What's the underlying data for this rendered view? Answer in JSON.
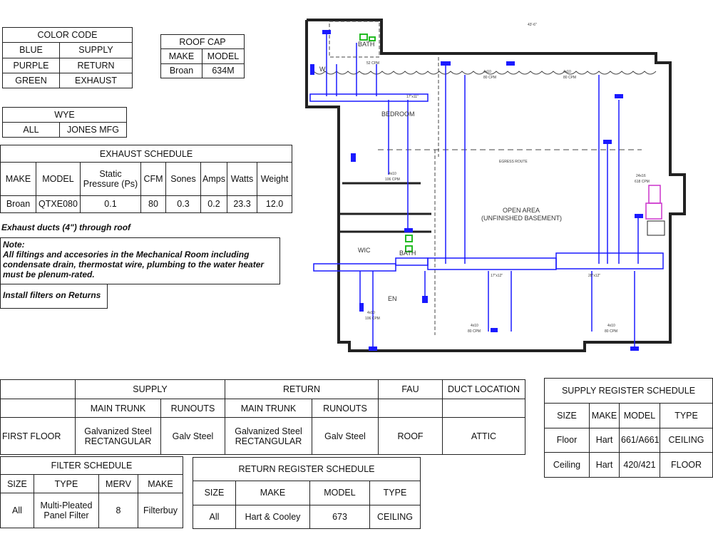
{
  "tables": {
    "color_code": {
      "rows": [
        [
          {
            "t": "COLOR CODE",
            "c": 2
          }
        ],
        [
          {
            "t": "BLUE"
          },
          {
            "t": "SUPPLY"
          }
        ],
        [
          {
            "t": "PURPLE"
          },
          {
            "t": "RETURN"
          }
        ],
        [
          {
            "t": "GREEN"
          },
          {
            "t": "EXHAUST"
          }
        ]
      ]
    },
    "roof_cap": {
      "rows": [
        [
          {
            "t": "ROOF CAP",
            "c": 2
          }
        ],
        [
          {
            "t": "MAKE"
          },
          {
            "t": "MODEL"
          }
        ],
        [
          {
            "t": "Broan"
          },
          {
            "t": "634M"
          }
        ]
      ]
    },
    "wye": {
      "rows": [
        [
          {
            "t": "WYE",
            "c": 2
          }
        ],
        [
          {
            "t": "ALL"
          },
          {
            "t": "JONES MFG"
          }
        ]
      ]
    },
    "exhaust_schedule": {
      "rows": [
        [
          {
            "t": "EXHAUST SCHEDULE",
            "c": 8
          }
        ],
        [
          {
            "t": "MAKE"
          },
          {
            "t": "MODEL"
          },
          {
            "t": "Static Pressure (Ps)"
          },
          {
            "t": "CFM"
          },
          {
            "t": "Sones"
          },
          {
            "t": "Amps"
          },
          {
            "t": "Watts"
          },
          {
            "t": "Weight"
          }
        ],
        [
          {
            "t": "Broan"
          },
          {
            "t": "QTXE080"
          },
          {
            "t": "0.1"
          },
          {
            "t": "80"
          },
          {
            "t": "0.3"
          },
          {
            "t": "0.2"
          },
          {
            "t": "23.3"
          },
          {
            "t": "12.0"
          }
        ]
      ]
    },
    "duct_schedule": {
      "rows": [
        [
          {
            "t": ""
          },
          {
            "t": "SUPPLY",
            "c": 2
          },
          {
            "t": "RETURN",
            "c": 2
          },
          {
            "t": "FAU"
          },
          {
            "t": "DUCT LOCATION"
          }
        ],
        [
          {
            "t": ""
          },
          {
            "t": "MAIN TRUNK"
          },
          {
            "t": "RUNOUTS"
          },
          {
            "t": "MAIN TRUNK"
          },
          {
            "t": "RUNOUTS"
          },
          {
            "t": ""
          },
          {
            "t": ""
          }
        ],
        [
          {
            "t": "FIRST FLOOR"
          },
          {
            "t": "Galvanized Steel RECTANGULAR"
          },
          {
            "t": "Galv Steel"
          },
          {
            "t": "Galvanized Steel RECTANGULAR"
          },
          {
            "t": "Galv Steel"
          },
          {
            "t": "ROOF"
          },
          {
            "t": "ATTIC"
          }
        ]
      ]
    },
    "filter_schedule": {
      "rows": [
        [
          {
            "t": "FILTER SCHEDULE",
            "c": 4
          }
        ],
        [
          {
            "t": "SIZE"
          },
          {
            "t": "TYPE"
          },
          {
            "t": "MERV"
          },
          {
            "t": "MAKE"
          }
        ],
        [
          {
            "t": "All"
          },
          {
            "t": "Multi-Pleated Panel Filter"
          },
          {
            "t": "8"
          },
          {
            "t": "Filterbuy"
          }
        ]
      ]
    },
    "return_register_schedule": {
      "rows": [
        [
          {
            "t": "RETURN REGISTER SCHEDULE",
            "c": 4
          }
        ],
        [
          {
            "t": "SIZE"
          },
          {
            "t": "MAKE"
          },
          {
            "t": "MODEL"
          },
          {
            "t": "TYPE"
          }
        ],
        [
          {
            "t": "All"
          },
          {
            "t": "Hart & Cooley"
          },
          {
            "t": "673"
          },
          {
            "t": "CEILING"
          }
        ]
      ]
    },
    "supply_register_schedule": {
      "rows": [
        [
          {
            "t": "SUPPLY REGISTER SCHEDULE",
            "c": 4
          }
        ],
        [
          {
            "t": "SIZE"
          },
          {
            "t": "MAKE"
          },
          {
            "t": "MODEL"
          },
          {
            "t": "TYPE"
          }
        ],
        [
          {
            "t": "Floor"
          },
          {
            "t": "Hart"
          },
          {
            "t": "661/A661"
          },
          {
            "t": "CEILING"
          }
        ],
        [
          {
            "t": "Ceiling"
          },
          {
            "t": "Hart"
          },
          {
            "t": "420/421"
          },
          {
            "t": "FLOOR"
          }
        ]
      ]
    }
  },
  "notes": {
    "exhaust_ducts": "Exhaust ducts (4\") through roof",
    "note_title": "Note:",
    "note_body": "All filtings and accesories in the Mechanical Room including condensate drain, thermostat wire, plumbing to the water heater must be plenum-rated.",
    "install_filters": "Install filters on Returns"
  },
  "plan": {
    "rooms": {
      "bath_top": "BATH",
      "w": "W",
      "bedroom": "BEDROOM",
      "open_area": "OPEN AREA",
      "unfinished": "(UNFINISHED BASEMENT)",
      "wic": "WIC",
      "bath_bottom": "BATH",
      "den": "EN"
    },
    "dims": {
      "overall": "43'-6\"",
      "trunk1": "17\"x11\"",
      "trunk2": "17\"x12\"",
      "trunk3": "28\"x12\"",
      "egress": "EGRESS ROUTE"
    },
    "cfm": {
      "r1": "4x10",
      "r1c": "80 CPM",
      "r2": "4x10",
      "r2c": "80 CPM",
      "r3": "4x10",
      "r3c": "106 CPM",
      "r4": "4x10",
      "r4c": "106 CPM",
      "r5": "4x10",
      "r5c": "80 CPM",
      "r6": "4x10",
      "r6c": "80 CPM",
      "fau": "24x16",
      "fauc": "618 CPM",
      "bath": "52 CPM"
    },
    "colors": {
      "supply": "#1a1aff",
      "return": "#cc33cc",
      "exhaust": "#22bb22",
      "wall": "#222222"
    }
  }
}
